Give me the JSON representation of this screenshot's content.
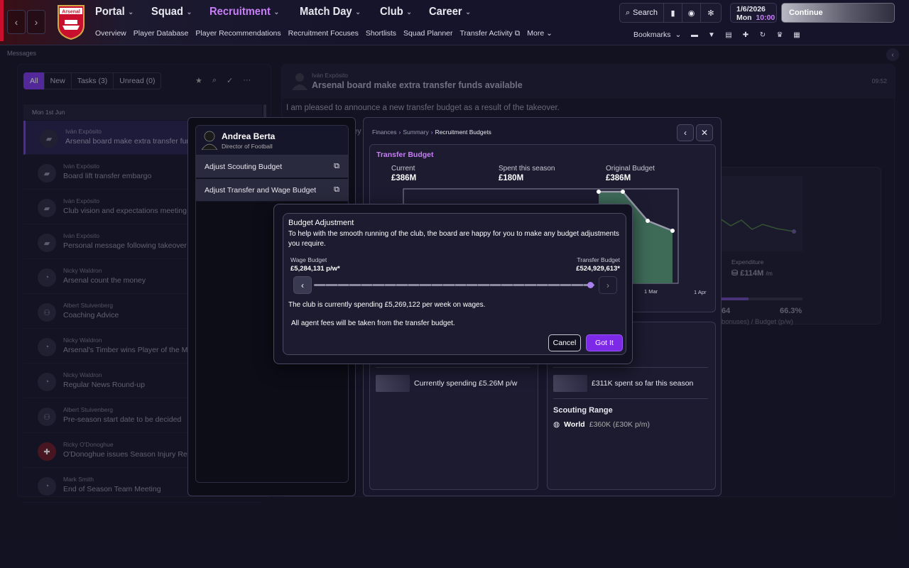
{
  "header": {
    "club": "Arsenal",
    "nav": [
      {
        "label": "Portal",
        "active": false
      },
      {
        "label": "Squad",
        "active": false
      },
      {
        "label": "Recruitment",
        "active": true
      },
      {
        "label": "Match Day",
        "active": false
      },
      {
        "label": "Club",
        "active": false
      },
      {
        "label": "Career",
        "active": false
      }
    ],
    "subnav": [
      "Overview",
      "Player Database",
      "Player Recommendations",
      "Recruitment Focuses",
      "Shortlists",
      "Squad Planner",
      "Transfer Activity",
      "More"
    ],
    "search_label": "Search",
    "date": "1/6/2026",
    "day": "Mon",
    "time": "10:00",
    "continue_label": "Continue",
    "bookmarks_label": "Bookmarks"
  },
  "breadcrumb": "Messages",
  "messages": {
    "filters": [
      "All",
      "New",
      "Tasks (3)",
      "Unread (0)"
    ],
    "date_group": "Mon 1st Jun",
    "items": [
      {
        "from": "Iván Expósito",
        "subject": "Arsenal board make extra transfer funds available",
        "selected": true
      },
      {
        "from": "Iván Expósito",
        "subject": "Board lift transfer embargo"
      },
      {
        "from": "Iván Expósito",
        "subject": "Club vision and expectations meeting"
      },
      {
        "from": "Iván Expósito",
        "subject": "Personal message following takeover ad"
      },
      {
        "from": "Nicky Waldron",
        "subject": "Arsenal count the money"
      },
      {
        "from": "Albert Stuivenberg",
        "subject": "Coaching Advice"
      },
      {
        "from": "Nicky Waldron",
        "subject": "Arsenal's Timber wins Player of the Mon"
      },
      {
        "from": "Nicky Waldron",
        "subject": "Regular News Round-up"
      },
      {
        "from": "Albert Stuivenberg",
        "subject": "Pre-season start date to be decided"
      },
      {
        "from": "Ricky O'Donoghue",
        "subject": "O'Donoghue issues Season Injury Repor"
      },
      {
        "from": "Mark Smith",
        "subject": "End of Season Team Meeting"
      }
    ]
  },
  "reading": {
    "from": "Iván Expósito",
    "subject": "Arsenal board make extra transfer funds available",
    "time": "09:52",
    "body": "I am pleased to announce a new transfer budget as a result of the takeover.",
    "fragment": "ey",
    "expenditure_label": "Expenditure",
    "expenditure_value": "£114M",
    "expenditure_unit": "/m",
    "stat_left": "64",
    "stat_right": "66.3%",
    "stat_caption": "bonuses) / Budget  (p/w)"
  },
  "director": {
    "name": "Andrea Berta",
    "role": "Director of Football",
    "options": [
      "Adjust Scouting Budget",
      "Adjust Transfer and Wage Budget"
    ]
  },
  "finance": {
    "crumbs": [
      "Finances",
      "Summary",
      "Recruitment Budgets"
    ],
    "card_title": "Transfer Budget",
    "stats": [
      {
        "label": "Current",
        "value": "£386M"
      },
      {
        "label": "Spent this season",
        "value": "£180M"
      },
      {
        "label": "Original Budget",
        "value": "£386M"
      }
    ],
    "x_ticks": [
      "1 Mar",
      "1 Apr"
    ],
    "wage_spending": "Currently spending £5.26M p/w",
    "scouting_spent": "£311K spent so far this season",
    "scouting_range_title": "Scouting Range",
    "scouting_range_value": "World",
    "scouting_range_detail": "£360K (£30K p/m)"
  },
  "modal": {
    "title": "Budget Adjustment",
    "description": "To help with the smooth running of the club, the board are happy for you to make any budget adjustments you require.",
    "wage_label": "Wage Budget",
    "wage_value": "£5,284,131 p/w*",
    "transfer_label": "Transfer Budget",
    "transfer_value": "£524,929,613*",
    "slider_fraction": 0.985,
    "spending_text": "The club is currently spending £5,269,122 per week on wages.",
    "fees_text": "All agent fees will be taken from the transfer budget.",
    "cancel_label": "Cancel",
    "confirm_label": "Got It"
  },
  "colors": {
    "accent": "#c87ef8",
    "primary_button": "#7c2ae8",
    "chart_fill": "#3e6a58",
    "brand_red": "#c8102e"
  }
}
